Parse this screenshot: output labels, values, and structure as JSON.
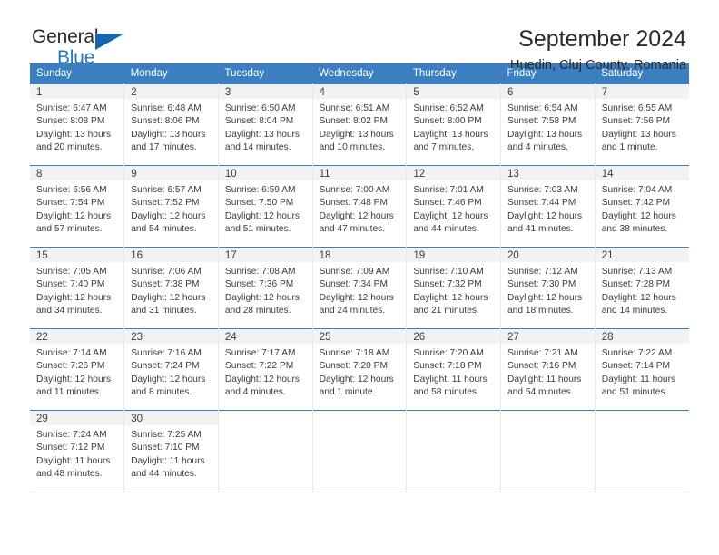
{
  "brand": {
    "name_top": "General",
    "name_bottom": "Blue",
    "logo_icon": "blue-triangle-icon"
  },
  "header": {
    "title": "September 2024",
    "subtitle": "Huedin, Cluj County, Romania"
  },
  "colors": {
    "header_blue": "#3c7fc1",
    "brand_blue": "#1f78c8",
    "daynum_band": "#f2f2f2",
    "text": "#3b3b3b"
  },
  "weekdays": [
    "Sunday",
    "Monday",
    "Tuesday",
    "Wednesday",
    "Thursday",
    "Friday",
    "Saturday"
  ],
  "weeks": [
    [
      {
        "day": "1",
        "sunrise": "Sunrise: 6:47 AM",
        "sunset": "Sunset: 8:08 PM",
        "daylight": "Daylight: 13 hours and 20 minutes."
      },
      {
        "day": "2",
        "sunrise": "Sunrise: 6:48 AM",
        "sunset": "Sunset: 8:06 PM",
        "daylight": "Daylight: 13 hours and 17 minutes."
      },
      {
        "day": "3",
        "sunrise": "Sunrise: 6:50 AM",
        "sunset": "Sunset: 8:04 PM",
        "daylight": "Daylight: 13 hours and 14 minutes."
      },
      {
        "day": "4",
        "sunrise": "Sunrise: 6:51 AM",
        "sunset": "Sunset: 8:02 PM",
        "daylight": "Daylight: 13 hours and 10 minutes."
      },
      {
        "day": "5",
        "sunrise": "Sunrise: 6:52 AM",
        "sunset": "Sunset: 8:00 PM",
        "daylight": "Daylight: 13 hours and 7 minutes."
      },
      {
        "day": "6",
        "sunrise": "Sunrise: 6:54 AM",
        "sunset": "Sunset: 7:58 PM",
        "daylight": "Daylight: 13 hours and 4 minutes."
      },
      {
        "day": "7",
        "sunrise": "Sunrise: 6:55 AM",
        "sunset": "Sunset: 7:56 PM",
        "daylight": "Daylight: 13 hours and 1 minute."
      }
    ],
    [
      {
        "day": "8",
        "sunrise": "Sunrise: 6:56 AM",
        "sunset": "Sunset: 7:54 PM",
        "daylight": "Daylight: 12 hours and 57 minutes."
      },
      {
        "day": "9",
        "sunrise": "Sunrise: 6:57 AM",
        "sunset": "Sunset: 7:52 PM",
        "daylight": "Daylight: 12 hours and 54 minutes."
      },
      {
        "day": "10",
        "sunrise": "Sunrise: 6:59 AM",
        "sunset": "Sunset: 7:50 PM",
        "daylight": "Daylight: 12 hours and 51 minutes."
      },
      {
        "day": "11",
        "sunrise": "Sunrise: 7:00 AM",
        "sunset": "Sunset: 7:48 PM",
        "daylight": "Daylight: 12 hours and 47 minutes."
      },
      {
        "day": "12",
        "sunrise": "Sunrise: 7:01 AM",
        "sunset": "Sunset: 7:46 PM",
        "daylight": "Daylight: 12 hours and 44 minutes."
      },
      {
        "day": "13",
        "sunrise": "Sunrise: 7:03 AM",
        "sunset": "Sunset: 7:44 PM",
        "daylight": "Daylight: 12 hours and 41 minutes."
      },
      {
        "day": "14",
        "sunrise": "Sunrise: 7:04 AM",
        "sunset": "Sunset: 7:42 PM",
        "daylight": "Daylight: 12 hours and 38 minutes."
      }
    ],
    [
      {
        "day": "15",
        "sunrise": "Sunrise: 7:05 AM",
        "sunset": "Sunset: 7:40 PM",
        "daylight": "Daylight: 12 hours and 34 minutes."
      },
      {
        "day": "16",
        "sunrise": "Sunrise: 7:06 AM",
        "sunset": "Sunset: 7:38 PM",
        "daylight": "Daylight: 12 hours and 31 minutes."
      },
      {
        "day": "17",
        "sunrise": "Sunrise: 7:08 AM",
        "sunset": "Sunset: 7:36 PM",
        "daylight": "Daylight: 12 hours and 28 minutes."
      },
      {
        "day": "18",
        "sunrise": "Sunrise: 7:09 AM",
        "sunset": "Sunset: 7:34 PM",
        "daylight": "Daylight: 12 hours and 24 minutes."
      },
      {
        "day": "19",
        "sunrise": "Sunrise: 7:10 AM",
        "sunset": "Sunset: 7:32 PM",
        "daylight": "Daylight: 12 hours and 21 minutes."
      },
      {
        "day": "20",
        "sunrise": "Sunrise: 7:12 AM",
        "sunset": "Sunset: 7:30 PM",
        "daylight": "Daylight: 12 hours and 18 minutes."
      },
      {
        "day": "21",
        "sunrise": "Sunrise: 7:13 AM",
        "sunset": "Sunset: 7:28 PM",
        "daylight": "Daylight: 12 hours and 14 minutes."
      }
    ],
    [
      {
        "day": "22",
        "sunrise": "Sunrise: 7:14 AM",
        "sunset": "Sunset: 7:26 PM",
        "daylight": "Daylight: 12 hours and 11 minutes."
      },
      {
        "day": "23",
        "sunrise": "Sunrise: 7:16 AM",
        "sunset": "Sunset: 7:24 PM",
        "daylight": "Daylight: 12 hours and 8 minutes."
      },
      {
        "day": "24",
        "sunrise": "Sunrise: 7:17 AM",
        "sunset": "Sunset: 7:22 PM",
        "daylight": "Daylight: 12 hours and 4 minutes."
      },
      {
        "day": "25",
        "sunrise": "Sunrise: 7:18 AM",
        "sunset": "Sunset: 7:20 PM",
        "daylight": "Daylight: 12 hours and 1 minute."
      },
      {
        "day": "26",
        "sunrise": "Sunrise: 7:20 AM",
        "sunset": "Sunset: 7:18 PM",
        "daylight": "Daylight: 11 hours and 58 minutes."
      },
      {
        "day": "27",
        "sunrise": "Sunrise: 7:21 AM",
        "sunset": "Sunset: 7:16 PM",
        "daylight": "Daylight: 11 hours and 54 minutes."
      },
      {
        "day": "28",
        "sunrise": "Sunrise: 7:22 AM",
        "sunset": "Sunset: 7:14 PM",
        "daylight": "Daylight: 11 hours and 51 minutes."
      }
    ],
    [
      {
        "day": "29",
        "sunrise": "Sunrise: 7:24 AM",
        "sunset": "Sunset: 7:12 PM",
        "daylight": "Daylight: 11 hours and 48 minutes."
      },
      {
        "day": "30",
        "sunrise": "Sunrise: 7:25 AM",
        "sunset": "Sunset: 7:10 PM",
        "daylight": "Daylight: 11 hours and 44 minutes."
      },
      {
        "day": "",
        "sunrise": "",
        "sunset": "",
        "daylight": ""
      },
      {
        "day": "",
        "sunrise": "",
        "sunset": "",
        "daylight": ""
      },
      {
        "day": "",
        "sunrise": "",
        "sunset": "",
        "daylight": ""
      },
      {
        "day": "",
        "sunrise": "",
        "sunset": "",
        "daylight": ""
      },
      {
        "day": "",
        "sunrise": "",
        "sunset": "",
        "daylight": ""
      }
    ]
  ]
}
